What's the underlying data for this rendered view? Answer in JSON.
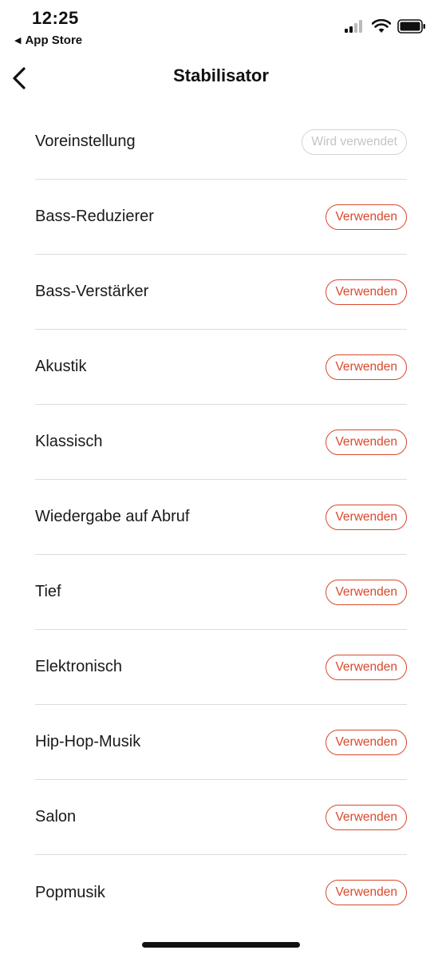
{
  "status_bar": {
    "time": "12:25",
    "back_app_label": "App Store"
  },
  "header": {
    "title": "Stabilisator"
  },
  "presets": [
    {
      "label": "Voreinstellung",
      "button": "Wird verwendet",
      "state": "in-use"
    },
    {
      "label": "Bass-Reduzierer",
      "button": "Verwenden",
      "state": "available"
    },
    {
      "label": "Bass-Verstärker",
      "button": "Verwenden",
      "state": "available"
    },
    {
      "label": "Akustik",
      "button": "Verwenden",
      "state": "available"
    },
    {
      "label": "Klassisch",
      "button": "Verwenden",
      "state": "available"
    },
    {
      "label": "Wiedergabe auf Abruf",
      "button": "Verwenden",
      "state": "available"
    },
    {
      "label": "Tief",
      "button": "Verwenden",
      "state": "available"
    },
    {
      "label": "Elektronisch",
      "button": "Verwenden",
      "state": "available"
    },
    {
      "label": "Hip-Hop-Musik",
      "button": "Verwenden",
      "state": "available"
    },
    {
      "label": "Salon",
      "button": "Verwenden",
      "state": "available"
    },
    {
      "label": "Popmusik",
      "button": "Verwenden",
      "state": "available"
    }
  ],
  "colors": {
    "accent": "#d9492c",
    "disabled": "#c4c4c4",
    "divider": "#dcdcdc"
  }
}
